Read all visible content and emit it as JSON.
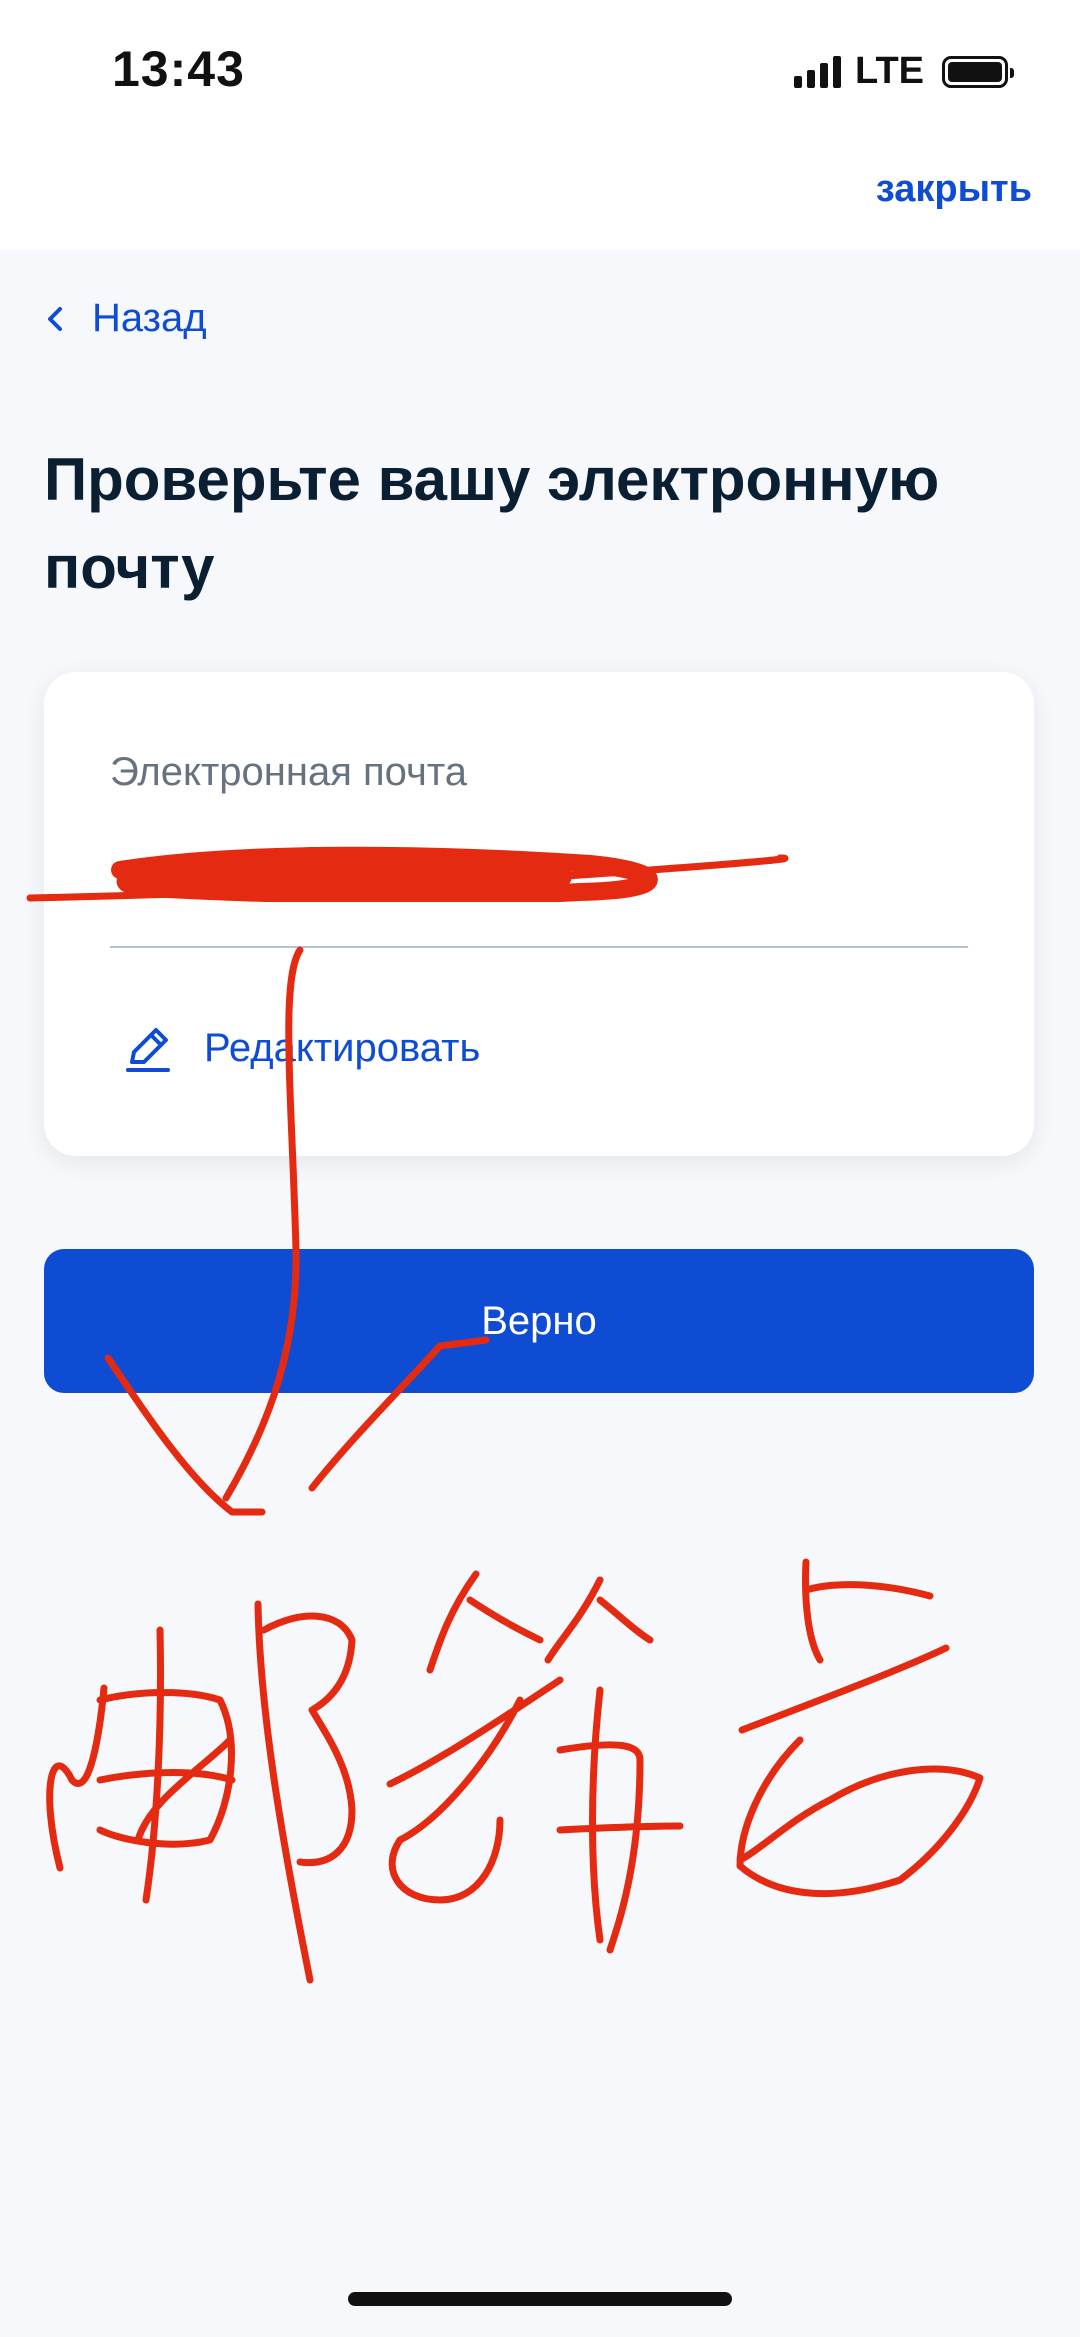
{
  "status_bar": {
    "time": "13:43",
    "network": "LTE"
  },
  "header": {
    "close_label": "закрыть"
  },
  "navigation": {
    "back_label": "Назад"
  },
  "page": {
    "title": "Проверьте вашу электронную почту"
  },
  "email_card": {
    "field_label": "Электронная почта",
    "field_value_redacted": true,
    "edit_label": "Редактировать"
  },
  "actions": {
    "confirm_label": "Верно"
  },
  "annotation": {
    "color": "#e52a12",
    "text": "邮箱号"
  },
  "colors": {
    "accent": "#0d4cd3",
    "title": "#0b1f33",
    "muted": "#66727f",
    "background": "#f6f8fb"
  }
}
